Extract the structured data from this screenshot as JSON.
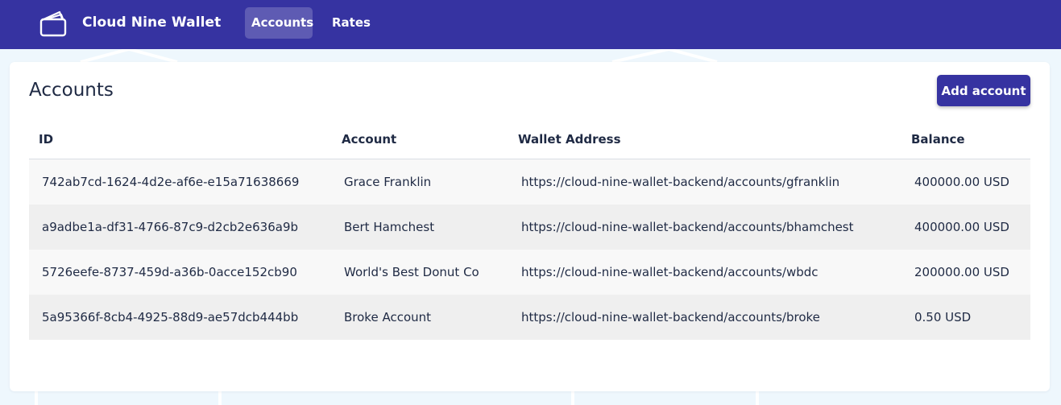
{
  "app": {
    "name": "Cloud Nine Wallet"
  },
  "nav": {
    "items": [
      {
        "label": "Accounts",
        "active": true
      },
      {
        "label": "Rates",
        "active": false
      }
    ]
  },
  "page": {
    "title": "Accounts",
    "add_button_label": "Add account"
  },
  "table": {
    "headers": [
      "ID",
      "Account",
      "Wallet Address",
      "Balance"
    ],
    "rows": [
      {
        "id": "742ab7cd-1624-4d2e-af6e-e15a71638669",
        "account": "Grace Franklin",
        "wallet_address": "https://cloud-nine-wallet-backend/accounts/gfranklin",
        "balance": "400000.00 USD"
      },
      {
        "id": "a9adbe1a-df31-4766-87c9-d2cb2e636a9b",
        "account": "Bert Hamchest",
        "wallet_address": "https://cloud-nine-wallet-backend/accounts/bhamchest",
        "balance": "400000.00 USD"
      },
      {
        "id": "5726eefe-8737-459d-a36b-0acce152cb90",
        "account": "World's Best Donut Co",
        "wallet_address": "https://cloud-nine-wallet-backend/accounts/wbdc",
        "balance": "200000.00 USD"
      },
      {
        "id": "5a95366f-8cb4-4925-88d9-ae57dcb444bb",
        "account": "Broke Account",
        "wallet_address": "https://cloud-nine-wallet-backend/accounts/broke",
        "balance": "0.50 USD"
      }
    ]
  },
  "colors": {
    "brand": "#3633a1",
    "page_background": "#eef7fd",
    "row_odd": "#f8f8f8",
    "row_even": "#efefef"
  },
  "icons": {
    "logo": "wallet-icon"
  }
}
